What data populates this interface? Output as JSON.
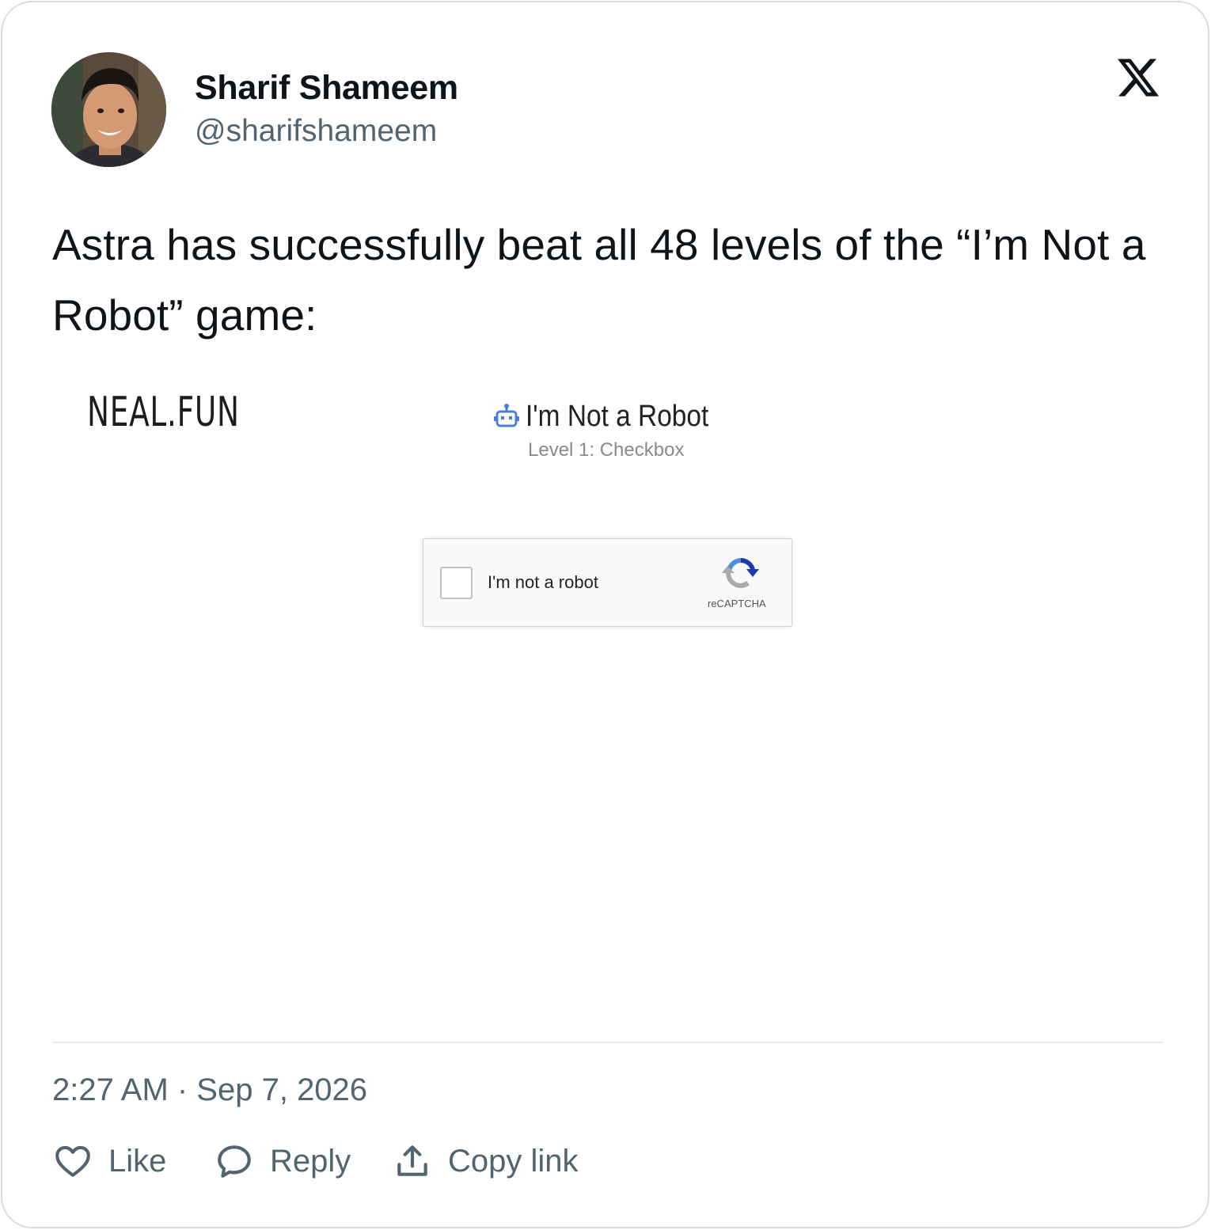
{
  "author": {
    "name": "Sharif Shameem",
    "handle": "@sharifshameem",
    "avatar_icon": "avatar-photo"
  },
  "platform_icon": "x-logo-icon",
  "tweet": {
    "text": "Astra has successfully beat all 48 levels of the “I’m Not a Robot” game:"
  },
  "media": {
    "site_logo": "NEAL.FUN",
    "game_title": "I'm Not a Robot",
    "level_label": "Level 1: Checkbox",
    "captcha": {
      "label": "I'm not a robot",
      "brand": "reCAPTCHA",
      "checked": false
    }
  },
  "timestamp": "2:27 AM · Sep 7, 2026",
  "actions": {
    "like": "Like",
    "reply": "Reply",
    "copy_link": "Copy link"
  },
  "colors": {
    "text_primary": "#0f1419",
    "text_secondary": "#536471",
    "border": "#d9dee3",
    "recaptcha_blue": "#1c3aa9",
    "recaptcha_light_blue": "#4a90e2",
    "recaptcha_grey": "#ababab"
  }
}
